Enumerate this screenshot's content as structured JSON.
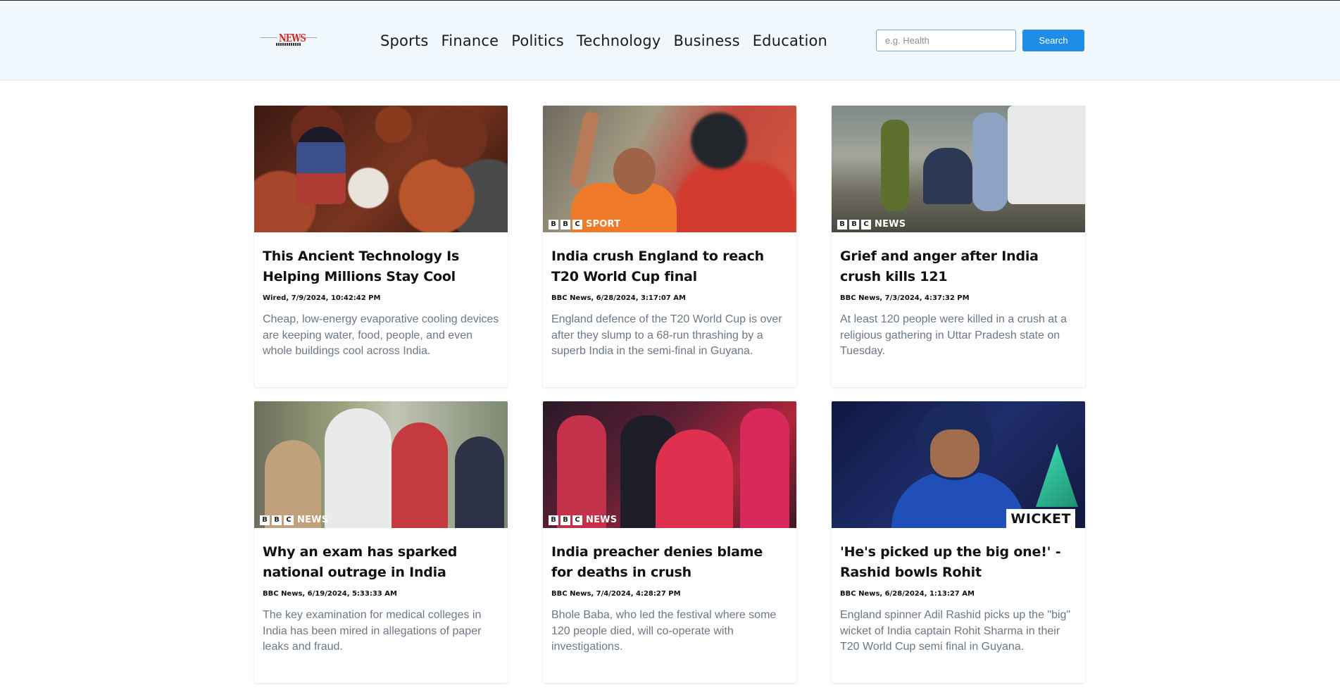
{
  "header": {
    "logo_text": "NEWS",
    "nav": [
      "Sports",
      "Finance",
      "Politics",
      "Technology",
      "Business",
      "Education"
    ],
    "search_placeholder": "e.g. Health",
    "search_value": "",
    "search_label": "Search"
  },
  "articles": [
    {
      "title": "This Ancient Technology Is Helping Millions Stay Cool",
      "meta": "Wired, 7/9/2024, 10:42:42 PM",
      "description": "Cheap, low-energy evaporative cooling devices are keeping water, food, people, and even whole buildings cool across India.",
      "badge": ""
    },
    {
      "title": "India crush England to reach T20 World Cup final",
      "meta": "BBC News, 6/28/2024, 3:17:07 AM",
      "description": "England defence of the T20 World Cup is over after they slump to a 68-run thrashing by a superb India in the semi-final in Guyana.",
      "badge": "SPORT"
    },
    {
      "title": "Grief and anger after India crush kills 121",
      "meta": "BBC News, 7/3/2024, 4:37:32 PM",
      "description": "At least 120 people were killed in a crush at a religious gathering in Uttar Pradesh state on Tuesday.",
      "badge": "NEWS"
    },
    {
      "title": "Why an exam has sparked national outrage in India",
      "meta": "BBC News, 6/19/2024, 5:33:33 AM",
      "description": "The key examination for medical colleges in India has been mired in allegations of paper leaks and fraud.",
      "badge": "NEWS"
    },
    {
      "title": "India preacher denies blame for deaths in crush",
      "meta": "BBC News, 7/4/2024, 4:28:27 PM",
      "description": "Bhole Baba, who led the festival where some 120 people died, will co-operate with investigations.",
      "badge": "NEWS"
    },
    {
      "title": "'He's picked up the big one!' - Rashid bowls Rohit",
      "meta": "BBC News, 6/28/2024, 1:13:27 AM",
      "description": "England spinner Adil Rashid picks up the \"big\" wicket of India captain Rohit Sharma in their T20 World Cup semi final in Guyana.",
      "badge": "WICKET"
    }
  ],
  "badge_letters": [
    "B",
    "B",
    "C"
  ],
  "colors": {
    "accent": "#1f8ce6",
    "header_bg": "#f0f7fd",
    "logo_red": "#d52222",
    "description_text": "#6b7889"
  }
}
